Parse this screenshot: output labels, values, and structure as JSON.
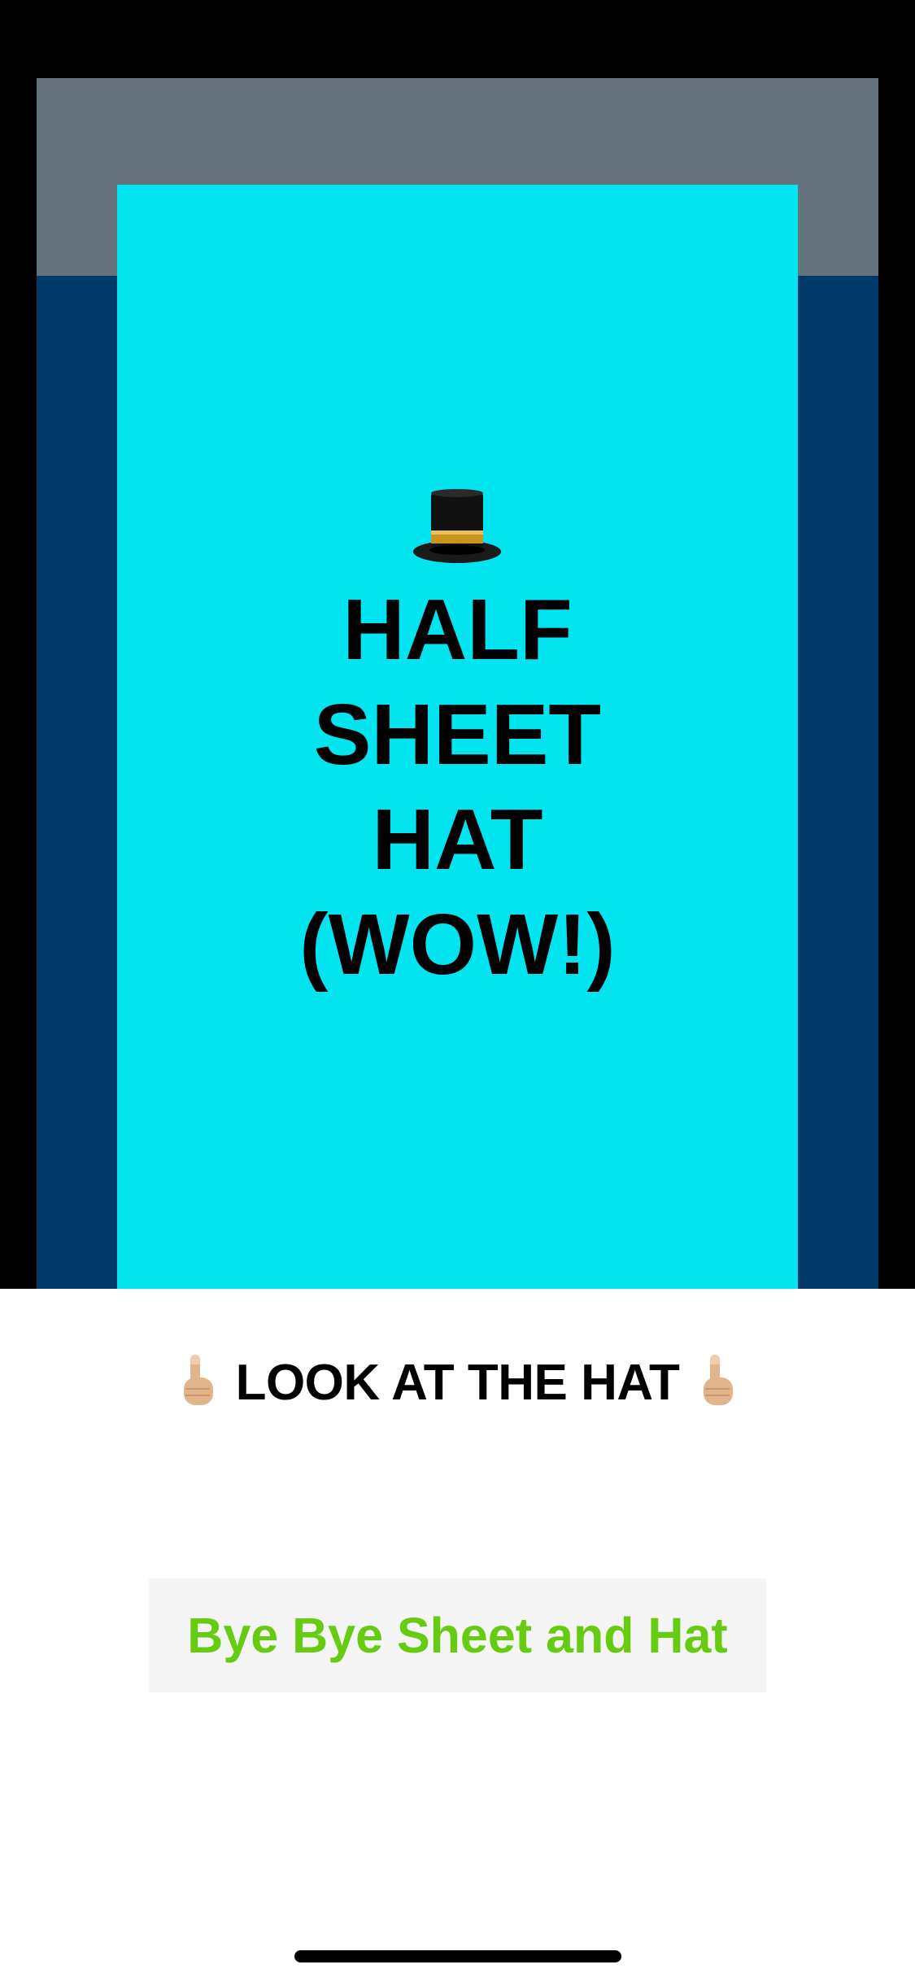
{
  "hat_card": {
    "icon": "top-hat-icon",
    "title": "HALF\nSHEET\nHAT\n(WOW!)"
  },
  "sheet": {
    "look_label": "LOOK AT THE HAT",
    "look_icon": "pointing-up-hand-icon",
    "dismiss_button_label": "Bye Bye Sheet and Hat"
  },
  "colors": {
    "hat_card_background": "#02e5f0",
    "presenting_background": "#013a6a",
    "presenting_header": "#65717b",
    "dismiss_button_text": "#66cc11",
    "dismiss_button_background": "#f5f5f5"
  }
}
